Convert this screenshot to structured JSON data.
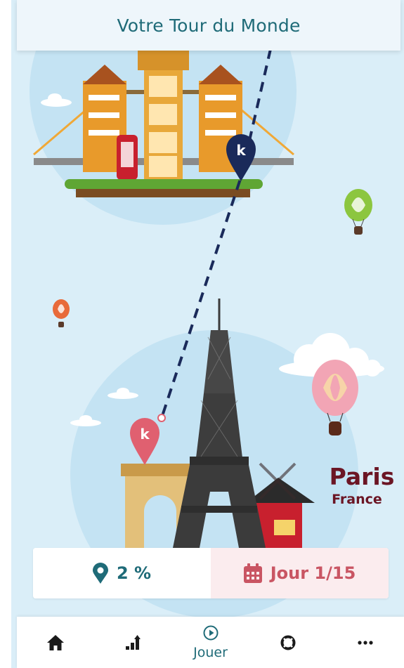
{
  "header": {
    "title": "Votre Tour du Monde"
  },
  "destination": {
    "city": "Paris",
    "country": "France"
  },
  "stats": {
    "progress": "2 %",
    "day": "Jour 1/15"
  },
  "tabs": [
    {
      "icon": "home-icon",
      "label": ""
    },
    {
      "icon": "ranking-icon",
      "label": ""
    },
    {
      "icon": "play-icon",
      "label": "Jouer",
      "active": true
    },
    {
      "icon": "lifebuoy-icon",
      "label": ""
    },
    {
      "icon": "more-icon",
      "label": ""
    }
  ],
  "colors": {
    "accent": "#1f6b78",
    "day": "#c95563",
    "city": "#6b1524",
    "sky": "#daeef8"
  }
}
